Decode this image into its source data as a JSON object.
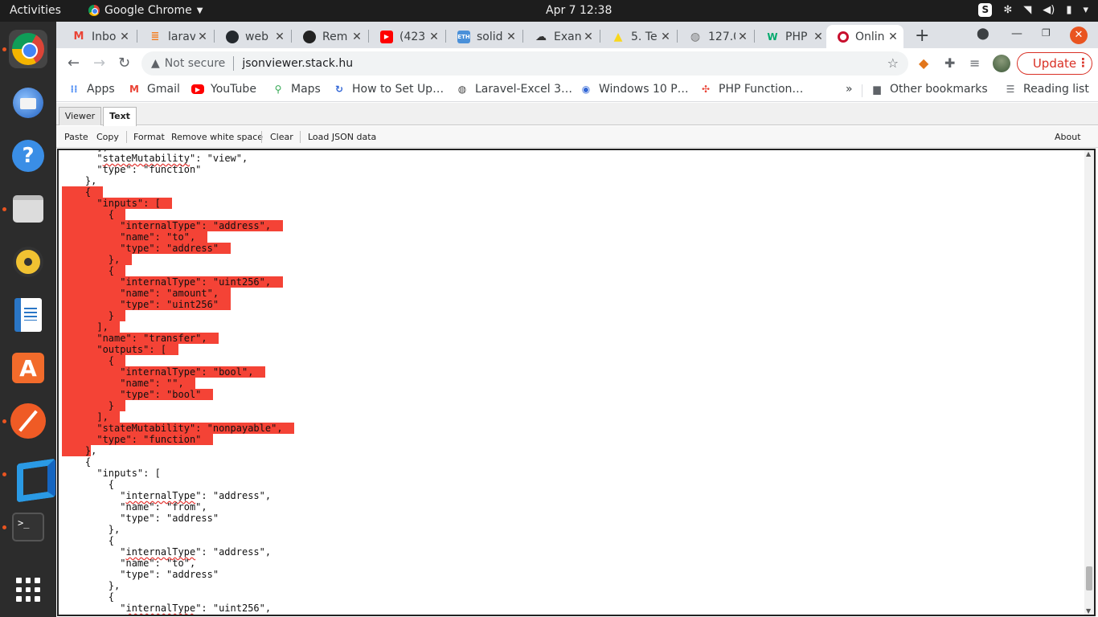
{
  "topbar": {
    "activities": "Activities",
    "app_name": "Google Chrome",
    "clock": "Apr 7  12:38",
    "tray_icons": [
      "skype-icon",
      "network-icon",
      "wifi-icon",
      "volume-icon",
      "battery-icon",
      "power-menu-icon"
    ]
  },
  "dock": {
    "apps": [
      "chrome",
      "thunderbird",
      "help",
      "files",
      "rhythmbox",
      "libreoffice-writer",
      "ubuntu-software",
      "postman",
      "vscode",
      "terminal",
      "show-applications"
    ]
  },
  "tabs": [
    {
      "title": "Inbo",
      "icon": "gmail-icon",
      "color": "#ea4335"
    },
    {
      "title": "larav",
      "icon": "stackoverflow-icon",
      "color": "#f48024"
    },
    {
      "title": "web",
      "icon": "github-icon",
      "color": "#24292e"
    },
    {
      "title": "Rem",
      "icon": "remix-icon",
      "color": "#222222"
    },
    {
      "title": "(423",
      "icon": "youtube-icon",
      "color": "#ff0000"
    },
    {
      "title": "solid",
      "icon": "ethereum-icon",
      "color": "#4a90d9"
    },
    {
      "title": "Exan",
      "icon": "cloud-icon",
      "color": "#333333"
    },
    {
      "title": "5. Te",
      "icon": "warning-icon",
      "color": "#f9d71c"
    },
    {
      "title": "127.0",
      "icon": "globe-icon",
      "color": "#777777"
    },
    {
      "title": "PHP",
      "icon": "w3schools-icon",
      "color": "#04aa6d"
    },
    {
      "title": "Onlin",
      "icon": "opera-icon",
      "color": "#c8102e",
      "active": true
    }
  ],
  "address_bar": {
    "security": "Not secure",
    "url": "jsonviewer.stack.hu",
    "update_label": "Update"
  },
  "bookmarks": [
    {
      "label": "Apps",
      "icon": "apps-grid-icon"
    },
    {
      "label": "Gmail",
      "icon": "gmail-icon"
    },
    {
      "label": "YouTube",
      "icon": "youtube-icon"
    },
    {
      "label": "Maps",
      "icon": "maps-icon"
    },
    {
      "label": "How to Set Up…",
      "icon": "refresh-blue-icon"
    },
    {
      "label": "Laravel-Excel 3…",
      "icon": "globe-icon"
    },
    {
      "label": "Windows 10 P…",
      "icon": "windows-icon"
    },
    {
      "label": "PHP Function…",
      "icon": "pinwheel-icon"
    }
  ],
  "other_bookmarks": "Other bookmarks",
  "reading_list": "Reading list",
  "jsonviewer": {
    "tabs": [
      "Viewer",
      "Text"
    ],
    "active_tab": "Text",
    "tools": [
      "Paste",
      "Copy",
      "Format",
      "Remove white space",
      "Clear",
      "Load JSON data"
    ],
    "about": "About"
  },
  "code_lines": [
    {
      "text": "      ],",
      "hl": false
    },
    {
      "text": "      \"stateMutability\": \"view\",",
      "hl": false,
      "squiggle": "stateMutability"
    },
    {
      "text": "      \"type\": \"function\"",
      "hl": false
    },
    {
      "text": "    },",
      "hl": false
    },
    {
      "text": "    {",
      "hl": true
    },
    {
      "text": "      \"inputs\": [",
      "hl": true
    },
    {
      "text": "        {",
      "hl": true
    },
    {
      "text": "          \"internalType\": \"address\",",
      "hl": true
    },
    {
      "text": "          \"name\": \"to\",",
      "hl": true
    },
    {
      "text": "          \"type\": \"address\"",
      "hl": true
    },
    {
      "text": "        },",
      "hl": true
    },
    {
      "text": "        {",
      "hl": true
    },
    {
      "text": "          \"internalType\": \"uint256\",",
      "hl": true
    },
    {
      "text": "          \"name\": \"amount\",",
      "hl": true
    },
    {
      "text": "          \"type\": \"uint256\"",
      "hl": true
    },
    {
      "text": "        }",
      "hl": true
    },
    {
      "text": "      ],",
      "hl": true
    },
    {
      "text": "      \"name\": \"transfer\",",
      "hl": true
    },
    {
      "text": "      \"outputs\": [",
      "hl": true
    },
    {
      "text": "        {",
      "hl": true
    },
    {
      "text": "          \"internalType\": \"bool\",",
      "hl": true
    },
    {
      "text": "          \"name\": \"\",",
      "hl": true
    },
    {
      "text": "          \"type\": \"bool\"",
      "hl": true
    },
    {
      "text": "        }",
      "hl": true
    },
    {
      "text": "      ],",
      "hl": true
    },
    {
      "text": "      \"stateMutability\": \"nonpayable\",",
      "hl": true
    },
    {
      "text": "      \"type\": \"function\"",
      "hl": true
    },
    {
      "text": "    },",
      "hl": "partial"
    },
    {
      "text": "    {",
      "hl": false
    },
    {
      "text": "      \"inputs\": [",
      "hl": false
    },
    {
      "text": "        {",
      "hl": false
    },
    {
      "text": "          \"internalType\": \"address\",",
      "hl": false,
      "squiggle": "internalType"
    },
    {
      "text": "          \"name\": \"from\",",
      "hl": false
    },
    {
      "text": "          \"type\": \"address\"",
      "hl": false
    },
    {
      "text": "        },",
      "hl": false
    },
    {
      "text": "        {",
      "hl": false
    },
    {
      "text": "          \"internalType\": \"address\",",
      "hl": false,
      "squiggle": "internalType"
    },
    {
      "text": "          \"name\": \"to\",",
      "hl": false
    },
    {
      "text": "          \"type\": \"address\"",
      "hl": false
    },
    {
      "text": "        },",
      "hl": false
    },
    {
      "text": "        {",
      "hl": false
    },
    {
      "text": "          \"internalType\": \"uint256\",",
      "hl": false,
      "squiggle": "internalType"
    }
  ],
  "colors": {
    "selection": "#f44336",
    "accent": "#e95420",
    "update": "#d93025"
  }
}
